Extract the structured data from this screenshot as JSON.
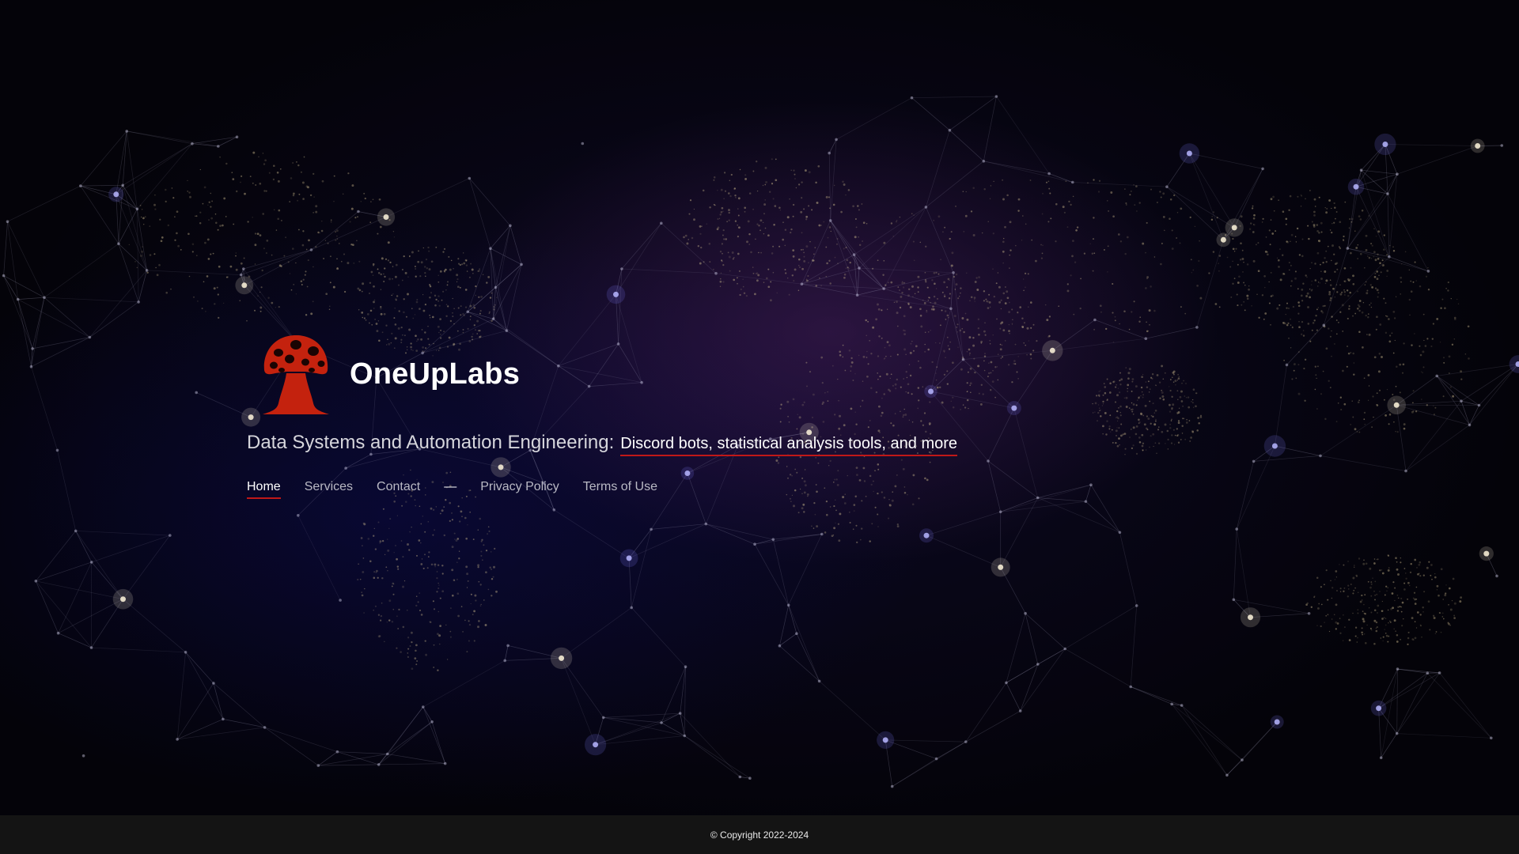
{
  "site": {
    "brand_name": "OneUpLabs",
    "tagline_prefix": "Data Systems and Automation Engineering:",
    "tagline_rotating": "Discord bots, statistical analysis tools, and more"
  },
  "nav": {
    "items": [
      {
        "label": "Home",
        "active": true
      },
      {
        "label": "Services"
      },
      {
        "label": "Contact"
      },
      {
        "label": "—"
      },
      {
        "label": "Privacy Policy"
      },
      {
        "label": "Terms of Use"
      }
    ]
  },
  "footer": {
    "copyright": "© Copyright 2022-2024"
  },
  "colors": {
    "accent": "#c01818",
    "logo": "#c4220e",
    "background": "#05040f",
    "footer_bg": "#141414"
  },
  "icons": {
    "logo": "mushroom-icon"
  }
}
